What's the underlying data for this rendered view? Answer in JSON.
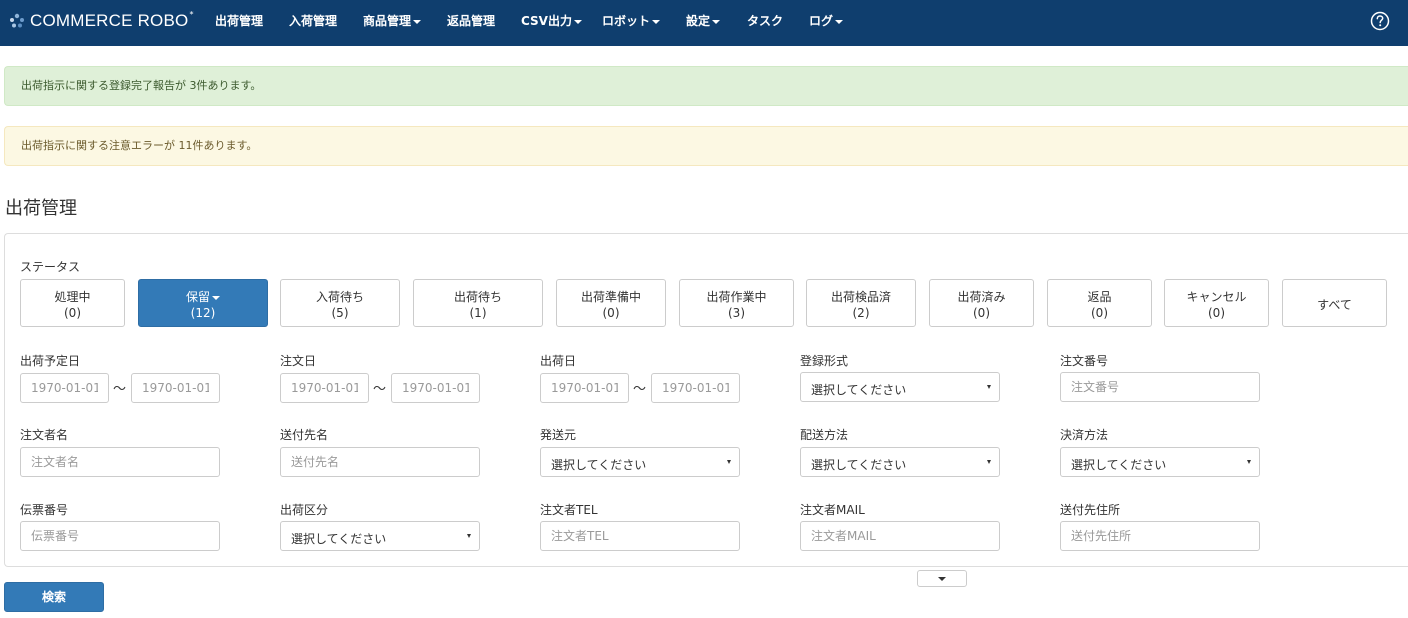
{
  "navbar": {
    "brand": "COMMERCE ROBO",
    "items": [
      {
        "label": "出荷管理",
        "dropdown": false
      },
      {
        "label": "入荷管理",
        "dropdown": false
      },
      {
        "label": "商品管理",
        "dropdown": true
      },
      {
        "label": "返品管理",
        "dropdown": false
      },
      {
        "label": "CSV出力",
        "dropdown": true
      },
      {
        "label": "ロボット",
        "dropdown": true
      },
      {
        "label": "設定",
        "dropdown": true
      },
      {
        "label": "タスク",
        "dropdown": false
      },
      {
        "label": "ログ",
        "dropdown": true
      }
    ],
    "help_icon": "question-circle-icon"
  },
  "alerts": {
    "success": "出荷指示に関する登録完了報告が 3件あります。",
    "warning": "出荷指示に関する注意エラーが 11件あります。"
  },
  "page_title": "出荷管理",
  "status": {
    "label": "ステータス",
    "buttons": [
      {
        "label": "処理中",
        "count": "(0)"
      },
      {
        "label": "保留",
        "count": "(12)",
        "active": true
      },
      {
        "label": "入荷待ち",
        "count": "(5)"
      },
      {
        "label": "出荷待ち",
        "count": "(1)"
      },
      {
        "label": "出荷準備中",
        "count": "(0)"
      },
      {
        "label": "出荷作業中",
        "count": "(3)"
      },
      {
        "label": "出荷検品済",
        "count": "(2)"
      },
      {
        "label": "出荷済み",
        "count": "(0)"
      },
      {
        "label": "返品",
        "count": "(0)"
      },
      {
        "label": "キャンセル",
        "count": "(0)"
      },
      {
        "label": "すべて",
        "count": ""
      }
    ]
  },
  "filters": {
    "tilde": "〜",
    "shipping_scheduled_date": {
      "label": "出荷予定日",
      "from": "1970-01-01",
      "to": "1970-01-01"
    },
    "order_date": {
      "label": "注文日",
      "from": "1970-01-01",
      "to": "1970-01-01"
    },
    "shipping_date": {
      "label": "出荷日",
      "from": "1970-01-01",
      "to": "1970-01-01"
    },
    "registration_format": {
      "label": "登録形式",
      "value": "選択してください"
    },
    "order_number": {
      "label": "注文番号",
      "placeholder": "注文番号"
    },
    "orderer_name": {
      "label": "注文者名",
      "placeholder": "注文者名"
    },
    "recipient_name": {
      "label": "送付先名",
      "placeholder": "送付先名"
    },
    "sender": {
      "label": "発送元",
      "value": "選択してください"
    },
    "delivery_method": {
      "label": "配送方法",
      "value": "選択してください"
    },
    "payment_method": {
      "label": "決済方法",
      "value": "選択してください"
    },
    "slip_number": {
      "label": "伝票番号",
      "placeholder": "伝票番号"
    },
    "shipping_category": {
      "label": "出荷区分",
      "value": "選択してください"
    },
    "orderer_tel": {
      "label": "注文者TEL",
      "placeholder": "注文者TEL"
    },
    "orderer_mail": {
      "label": "注文者MAIL",
      "placeholder": "注文者MAIL"
    },
    "recipient_address": {
      "label": "送付先住所",
      "placeholder": "送付先住所"
    }
  },
  "search_button": "検索"
}
